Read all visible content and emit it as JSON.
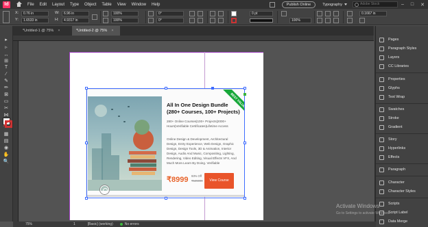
{
  "app": {
    "logo": "Id",
    "menu": [
      "File",
      "Edit",
      "Layout",
      "Type",
      "Object",
      "Table",
      "View",
      "Window",
      "Help"
    ],
    "publish_label": "Publish Online",
    "workspace_label": "Typography",
    "stock_search_placeholder": "Adobe Stock",
    "window_controls": [
      "–",
      "□",
      "✕"
    ]
  },
  "control": {
    "x_label": "X:",
    "x_value": "0.76 in",
    "y_label": "Y:",
    "y_value": "1.6533 in",
    "w_label": "W:",
    "w_value": "6.96 in",
    "h_label": "H:",
    "h_value": "4.9317 in",
    "scale_x": "100%",
    "scale_y": "100%",
    "rotate": "0°",
    "shear": "0°",
    "stroke_weight": "0 pt",
    "opacity": "100%",
    "gap": "0.1667 in"
  },
  "tabs": [
    {
      "label": "*Untitled-1 @ 75%",
      "close": "×"
    },
    {
      "label": "*Untitled-2 @ 75%",
      "close": "×"
    }
  ],
  "tools": [
    "▸",
    "▹",
    "↔",
    "⊞",
    "T",
    "∕",
    "✎",
    "✏",
    "⊠",
    "▭",
    "✂",
    "⋈",
    "▦",
    "▤",
    "◉",
    "✋",
    "🔍"
  ],
  "banner": {
    "ribbon": "BEST VALUE",
    "title": "All In One Design Bundle",
    "subtitle": "(280+ Courses, 100+ Projects)",
    "meta": "280+ Online Courses|100+ Projects|2000+ Hours|Verifiable Certificates|Lifetime Access",
    "description": "Online Design & Development, Architectural Design, Entry Experience, Web Design, Graphic Design, Design Tools, 3D & Animation, Interior Design, Audio And Music, Compositing, Lighting, Rendering, Video Editing, Visual Effects VFX, And Much More.Learn By Doing. Verifiable",
    "price": "₹8999",
    "discount": "93% Off",
    "old_price": "₹125999",
    "button": "View Course"
  },
  "panels": [
    {
      "icon": "pages-icon",
      "label": "Pages"
    },
    {
      "icon": "paragraph-styles-icon",
      "label": "Paragraph Styles"
    },
    {
      "icon": "layers-icon",
      "label": "Layers"
    },
    {
      "icon": "cc-libraries-icon",
      "label": "CC Libraries"
    },
    {
      "icon": "properties-icon",
      "label": "Properties"
    },
    {
      "icon": "glyphs-icon",
      "label": "Glyphs"
    },
    {
      "icon": "text-wrap-icon",
      "label": "Text Wrap"
    },
    {
      "icon": "swatches-icon",
      "label": "Swatches"
    },
    {
      "icon": "stroke-icon",
      "label": "Stroke"
    },
    {
      "icon": "gradient-icon",
      "label": "Gradient"
    },
    {
      "icon": "story-icon",
      "label": "Story"
    },
    {
      "icon": "hyperlinks-icon",
      "label": "Hyperlinks"
    },
    {
      "icon": "effects-icon",
      "label": "Effects"
    },
    {
      "icon": "paragraph-icon",
      "label": "Paragraph"
    },
    {
      "icon": "character-icon",
      "label": "Character"
    },
    {
      "icon": "character-styles-icon",
      "label": "Character Styles"
    },
    {
      "icon": "scripts-icon",
      "label": "Scripts"
    },
    {
      "icon": "script-label-icon",
      "label": "Script Label"
    },
    {
      "icon": "data-merge-icon",
      "label": "Data Merge"
    }
  ],
  "status": {
    "zoom": "75%",
    "page": "1",
    "style": "[Basic] (working)",
    "preflight": "No errors"
  },
  "watermark": {
    "title": "Activate Windows",
    "subtitle": "Go to Settings to activate Windows."
  }
}
